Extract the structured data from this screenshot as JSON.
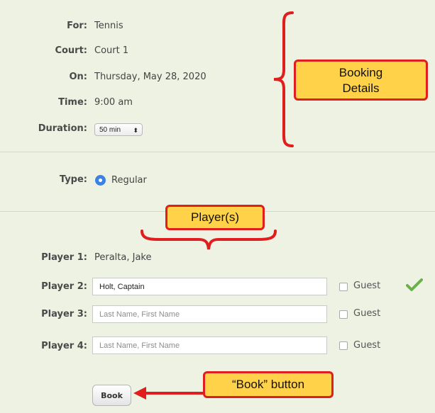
{
  "booking": {
    "for_label": "For:",
    "for_value": "Tennis",
    "court_label": "Court:",
    "court_value": "Court 1",
    "on_label": "On:",
    "on_value": "Thursday, May 28, 2020",
    "time_label": "Time:",
    "time_value": "9:00 am",
    "duration_label": "Duration:",
    "duration_value": "50 min",
    "duration_arrows": "⬍"
  },
  "type": {
    "label": "Type:",
    "option": "Regular",
    "selected": true
  },
  "players": [
    {
      "label": "Player 1:",
      "value": "Peralta, Jake"
    },
    {
      "label": "Player 2:",
      "value": "Holt, Captain",
      "guest_label": "Guest",
      "verified": true
    },
    {
      "label": "Player 3:",
      "value": "",
      "placeholder": "Last Name, First Name",
      "guest_label": "Guest"
    },
    {
      "label": "Player 4:",
      "value": "",
      "placeholder": "Last Name, First Name",
      "guest_label": "Guest"
    }
  ],
  "book_button": "Book",
  "annotations": {
    "booking_details_line1": "Booking",
    "booking_details_line2": "Details",
    "players": "Player(s)",
    "book_button": "“Book” button"
  },
  "colors": {
    "background": "#edf2e3",
    "callout_fill": "#ffd24a",
    "callout_border": "#e01e1e",
    "radio": "#3b82e8",
    "check": "#6ab04c"
  }
}
